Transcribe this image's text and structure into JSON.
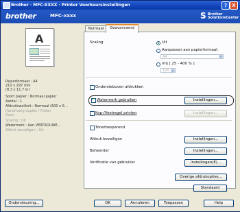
{
  "window": {
    "title": "Brother · MFC-XXXX · Printer Voorkeursinstellingen",
    "help_glyph": "?",
    "close_glyph": "X"
  },
  "header": {
    "brand": "brother",
    "model": "MFC-xxxx",
    "solutions_line1": "Brother",
    "solutions_line2": "SolutionsCenter"
  },
  "tabs": [
    "Normaal",
    "Geavanceerd"
  ],
  "summary": [
    "Papierformaat : A4",
    "210 x 297 mm",
    "(8.3 x 11.7 in)",
    "Soort papier : Normaal papier",
    "Aantal : 1",
    "Afdrukkwaliteit : Normaal (600 x 6...",
    "Handmatig duplex / Folder",
    "Geen",
    "Scaling : Uit",
    "Watermerk : Aan VERTROUWE...",
    "Afdruk beveiligen : Uit"
  ],
  "scaling": {
    "label": "Scaling",
    "option_off": "Uit",
    "option_fit": "Aanpassen aan papierformaat",
    "paper_value": "A4",
    "option_free": "Vrij [ 25 - 400 % ]",
    "percent_value": "100"
  },
  "options": {
    "ondersteboven": "Ondersteboven afdrukken",
    "watermerk": "Watermerk gebruiken",
    "kopvoet": "Kop-/Voetregel printen",
    "toner": "Tonerbesparend",
    "afdruk_beveiligen": "Afdruk beveiligen",
    "beheerder": "Beheerder",
    "verificatie": "Verificatie van gebruiker"
  },
  "buttons": {
    "instellingen": "Instellingen...",
    "instellingen_e": "Instellingen(E)...",
    "overige": "Overige afdrukopties...",
    "standaard": "Standaard",
    "ondersteuning": "Ondersteuning...",
    "ok": "OK",
    "annuleren": "Annuleren",
    "toepassen": "Toepassen",
    "help": "Help"
  }
}
